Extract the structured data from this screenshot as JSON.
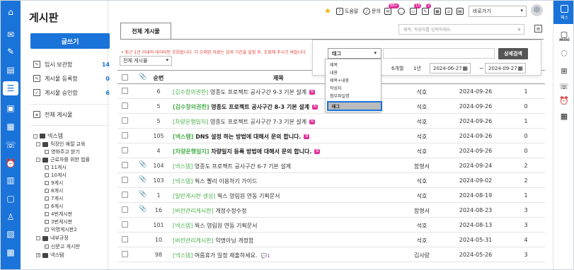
{
  "sidebar": {
    "title": "게시판",
    "write_label": "글쓰기",
    "shortcuts": [
      {
        "label": "임시 보관함",
        "count": "14"
      },
      {
        "label": "게시물 등록함",
        "count": "0"
      },
      {
        "label": "게시물 승인함",
        "count": "6"
      }
    ],
    "all_posts": "전체 게시물",
    "tree": [
      "넥스템",
      "직장인 예절 교육",
      "영화주고 받기",
      "근로자를 위한 법률",
      "11게시",
      "10게시",
      "9게시",
      "8게시",
      "7게시",
      "6게시",
      "4번게시판",
      "3번게시판",
      "익명게시판2",
      "내부규정",
      "신문고 게시판",
      "넥스템"
    ]
  },
  "topbar": {
    "help": "도움말",
    "inquiry": "문의",
    "badge_mail": "99+",
    "badge_chat": "15",
    "badge_note": "2",
    "goto_label": "바로가기"
  },
  "tab_label": "전체 게시물",
  "search_placeholder": "제목, 작성자를 입력하세요.",
  "notice": "• 최근 1년 이내의 데이터만 조회됩니다. 더 오래된 자료는 검색 기간을 설정 후, 조회해 주시기 바랍니다.",
  "board_select": "전체 게시물",
  "table": {
    "headers": {
      "num": "순번",
      "title": "제목"
    },
    "rows": [
      {
        "num": "6",
        "cat": "[김수창의권한]",
        "title": "영종도 프로젝트 공사구간 9-3 기본 설계",
        "new": "N",
        "bold": false,
        "clip": false,
        "comment": "",
        "writer": "석호",
        "date": "2024-09-26",
        "views": "1"
      },
      {
        "num": "5",
        "cat": "[김수창의권한]",
        "title": "영종도 프로젝트 공사구간 8-3 기본 설계",
        "new": "N",
        "bold": true,
        "clip": false,
        "comment": "",
        "writer": "석호",
        "date": "2024-09-26",
        "views": "0"
      },
      {
        "num": "5",
        "cat": "[차량운행일지]",
        "title": "영종도 프로젝트 공사구간 7-3 기본 설계",
        "new": "N",
        "bold": false,
        "clip": false,
        "comment": "",
        "writer": "석호",
        "date": "2024-09-26",
        "views": "1"
      },
      {
        "num": "105",
        "cat": "[넥스템]",
        "title": "DNS 설정 하는 방법에 대해서 문의 합니다.",
        "new": "N",
        "bold": true,
        "clip": false,
        "comment": "",
        "writer": "석호",
        "date": "2024-09-26",
        "views": "0"
      },
      {
        "num": "4",
        "cat": "[차량운행일지]",
        "title": "차량일지 등록 방법에 대해서 문의 합니다.",
        "new": "N",
        "bold": true,
        "clip": false,
        "comment": "",
        "writer": "석호",
        "date": "2024-09-26",
        "views": "0"
      },
      {
        "num": "104",
        "cat": "[넥스템]",
        "title": "영종도 프로젝트 공사구간 6-7 기본 설계",
        "new": "",
        "bold": false,
        "clip": true,
        "comment": "",
        "writer": "함형서",
        "date": "2024-09-24",
        "views": "2"
      },
      {
        "num": "103",
        "cat": "[넥스템]",
        "title": "웍스 빨리 이용하기 가이드",
        "new": "",
        "bold": false,
        "clip": true,
        "comment": "",
        "writer": "석호",
        "date": "2024-09-02",
        "views": "2"
      },
      {
        "num": "1",
        "cat": "[일반게시판 생성]",
        "title": "웍스 영림원 연동 기획문서",
        "new": "",
        "bold": false,
        "clip": true,
        "comment": "",
        "writer": "석호",
        "date": "2024-08-19",
        "views": "1"
      },
      {
        "num": "16",
        "cat": "[버전관리게시판]",
        "title": "개정수정수정",
        "new": "",
        "bold": false,
        "clip": true,
        "comment": "",
        "writer": "함형서",
        "date": "2024-08-23",
        "views": "3"
      },
      {
        "num": "101",
        "cat": "[넥스템]",
        "title": "웍스 영림원 연동 기획문서",
        "new": "",
        "bold": false,
        "clip": false,
        "comment": "",
        "writer": "석호",
        "date": "2024-08-13",
        "views": "3"
      },
      {
        "num": "10",
        "cat": "[버전관리게시판]",
        "title": "익명아닝 개정함",
        "new": "",
        "bold": false,
        "clip": false,
        "comment": "",
        "writer": "석호",
        "date": "2024-05-31",
        "views": "4"
      },
      {
        "num": "98",
        "cat": "[넥스템]",
        "title": "여름휴가 일정 제출하세요.",
        "new": "",
        "bold": false,
        "clip": false,
        "comment": "1",
        "writer": "김사랑",
        "date": "2024-05-26",
        "views": "3"
      }
    ]
  },
  "advanced": {
    "field_selected": "태그",
    "button": "상세검색",
    "periods": [
      "6개월",
      "1년"
    ],
    "date_from": "2024-06-27",
    "date_to": "2024-09-27",
    "tilde": "~",
    "options": [
      "제목",
      "내용",
      "제목+내용",
      "작성자",
      "첨부파일명",
      "태그"
    ]
  },
  "rightbar": {
    "works_label": "웍스",
    "mini_label": "mini"
  },
  "colors": {
    "primary": "#1a73d9",
    "category": "#4caf50",
    "notice": "#e03c31",
    "new_badge": "#e0309a"
  }
}
